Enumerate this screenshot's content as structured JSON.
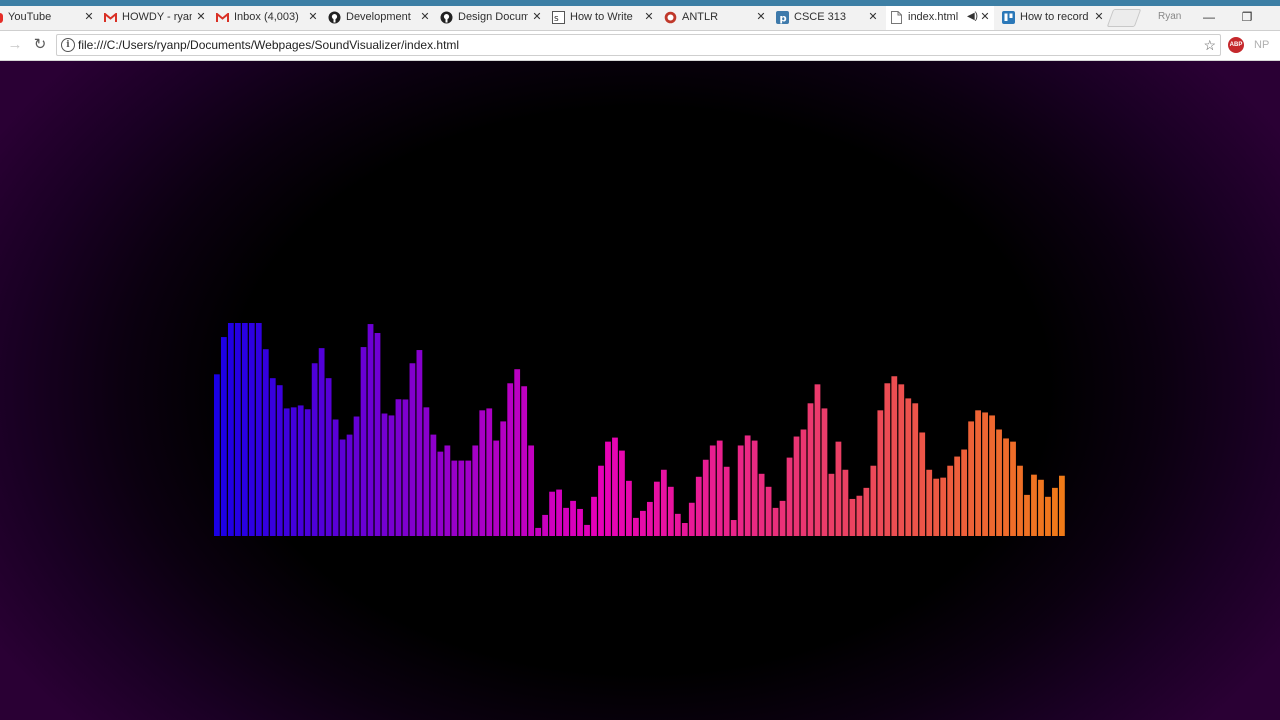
{
  "browser": {
    "tabs": [
      {
        "label": "YouTube",
        "icon": "youtube-icon",
        "active": false
      },
      {
        "label": "HOWDY - ryan",
        "icon": "gmail-icon",
        "active": false
      },
      {
        "label": "Inbox (4,003)",
        "icon": "gmail-icon",
        "active": false
      },
      {
        "label": "Development",
        "icon": "github-icon",
        "active": false
      },
      {
        "label": "Design Docum",
        "icon": "github-icon",
        "active": false
      },
      {
        "label": "How to Write",
        "icon": "scribd-icon",
        "active": false
      },
      {
        "label": "ANTLR",
        "icon": "antlr-icon",
        "active": false
      },
      {
        "label": "CSCE 313",
        "icon": "piazza-icon",
        "active": false
      },
      {
        "label": "index.html",
        "icon": "document-icon",
        "active": true,
        "audio": true
      },
      {
        "label": "How to record",
        "icon": "trello-icon",
        "active": false
      }
    ],
    "profile_name": "Ryan",
    "url": "file:///C:/Users/ryanp/Documents/Webpages/SoundVisualizer/index.html",
    "extensions": {
      "adblock": "ABP",
      "np": "NP"
    },
    "window_controls": {
      "minimize": "—",
      "restore": "❐"
    }
  },
  "visualizer": {
    "gradient_start": "#1a00e6",
    "gradient_mid": "#e600b8",
    "gradient_end": "#f07a18",
    "bar_count": 122,
    "levels": [
      0.759,
      0.934,
      1.0,
      1.0,
      1.0,
      1.0,
      1.0,
      0.877,
      0.741,
      0.708,
      0.599,
      0.604,
      0.613,
      0.595,
      0.811,
      0.882,
      0.741,
      0.547,
      0.453,
      0.476,
      0.561,
      0.887,
      0.995,
      0.953,
      0.575,
      0.566,
      0.642,
      0.641,
      0.811,
      0.873,
      0.604,
      0.476,
      0.396,
      0.425,
      0.354,
      0.354,
      0.354,
      0.425,
      0.59,
      0.599,
      0.448,
      0.538,
      0.717,
      0.783,
      0.703,
      0.425,
      0.038,
      0.099,
      0.208,
      0.218,
      0.132,
      0.165,
      0.127,
      0.052,
      0.184,
      0.33,
      0.443,
      0.462,
      0.401,
      0.259,
      0.085,
      0.118,
      0.16,
      0.255,
      0.311,
      0.231,
      0.104,
      0.061,
      0.156,
      0.278,
      0.358,
      0.425,
      0.448,
      0.325,
      0.075,
      0.425,
      0.472,
      0.448,
      0.292,
      0.231,
      0.132,
      0.165,
      0.368,
      0.467,
      0.5,
      0.623,
      0.712,
      0.599,
      0.292,
      0.443,
      0.311,
      0.174,
      0.189,
      0.226,
      0.33,
      0.59,
      0.717,
      0.75,
      0.712,
      0.646,
      0.623,
      0.486,
      0.311,
      0.269,
      0.274,
      0.33,
      0.373,
      0.406,
      0.538,
      0.59,
      0.58,
      0.566,
      0.5,
      0.458,
      0.443,
      0.33,
      0.193,
      0.288,
      0.264,
      0.184,
      0.226,
      0.283
    ]
  }
}
